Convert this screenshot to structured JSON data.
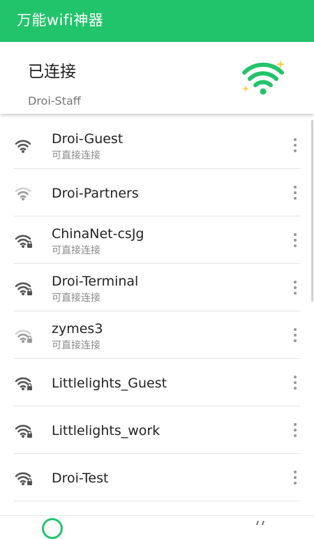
{
  "app": {
    "title": "万能wifi神器"
  },
  "colors": {
    "brand": "#22c46b",
    "icon_dark": "#555555",
    "icon_light": "#9a9a9a"
  },
  "connection": {
    "status": "已连接",
    "ssid": "Droi-Staff",
    "icon": "wifi-sparkle-icon"
  },
  "networks": [
    {
      "ssid": "Droi-Guest",
      "sub": "可直接连接",
      "icon": "wifi-icon"
    },
    {
      "ssid": "Droi-Partners",
      "sub": "",
      "icon": "wifi-weak-icon"
    },
    {
      "ssid": "ChinaNet-csJg",
      "sub": "可直接连接",
      "icon": "wifi-lock-icon"
    },
    {
      "ssid": "Droi-Terminal",
      "sub": "可直接连接",
      "icon": "wifi-lock-icon"
    },
    {
      "ssid": "zymes3",
      "sub": "可直接连接",
      "icon": "wifi-lock-weak-icon"
    },
    {
      "ssid": "Littlelights_Guest",
      "sub": "",
      "icon": "wifi-lock-icon"
    },
    {
      "ssid": "Littlelights_work",
      "sub": "",
      "icon": "wifi-lock-icon"
    },
    {
      "ssid": "Droi-Test",
      "sub": "",
      "icon": "wifi-lock-icon"
    }
  ]
}
